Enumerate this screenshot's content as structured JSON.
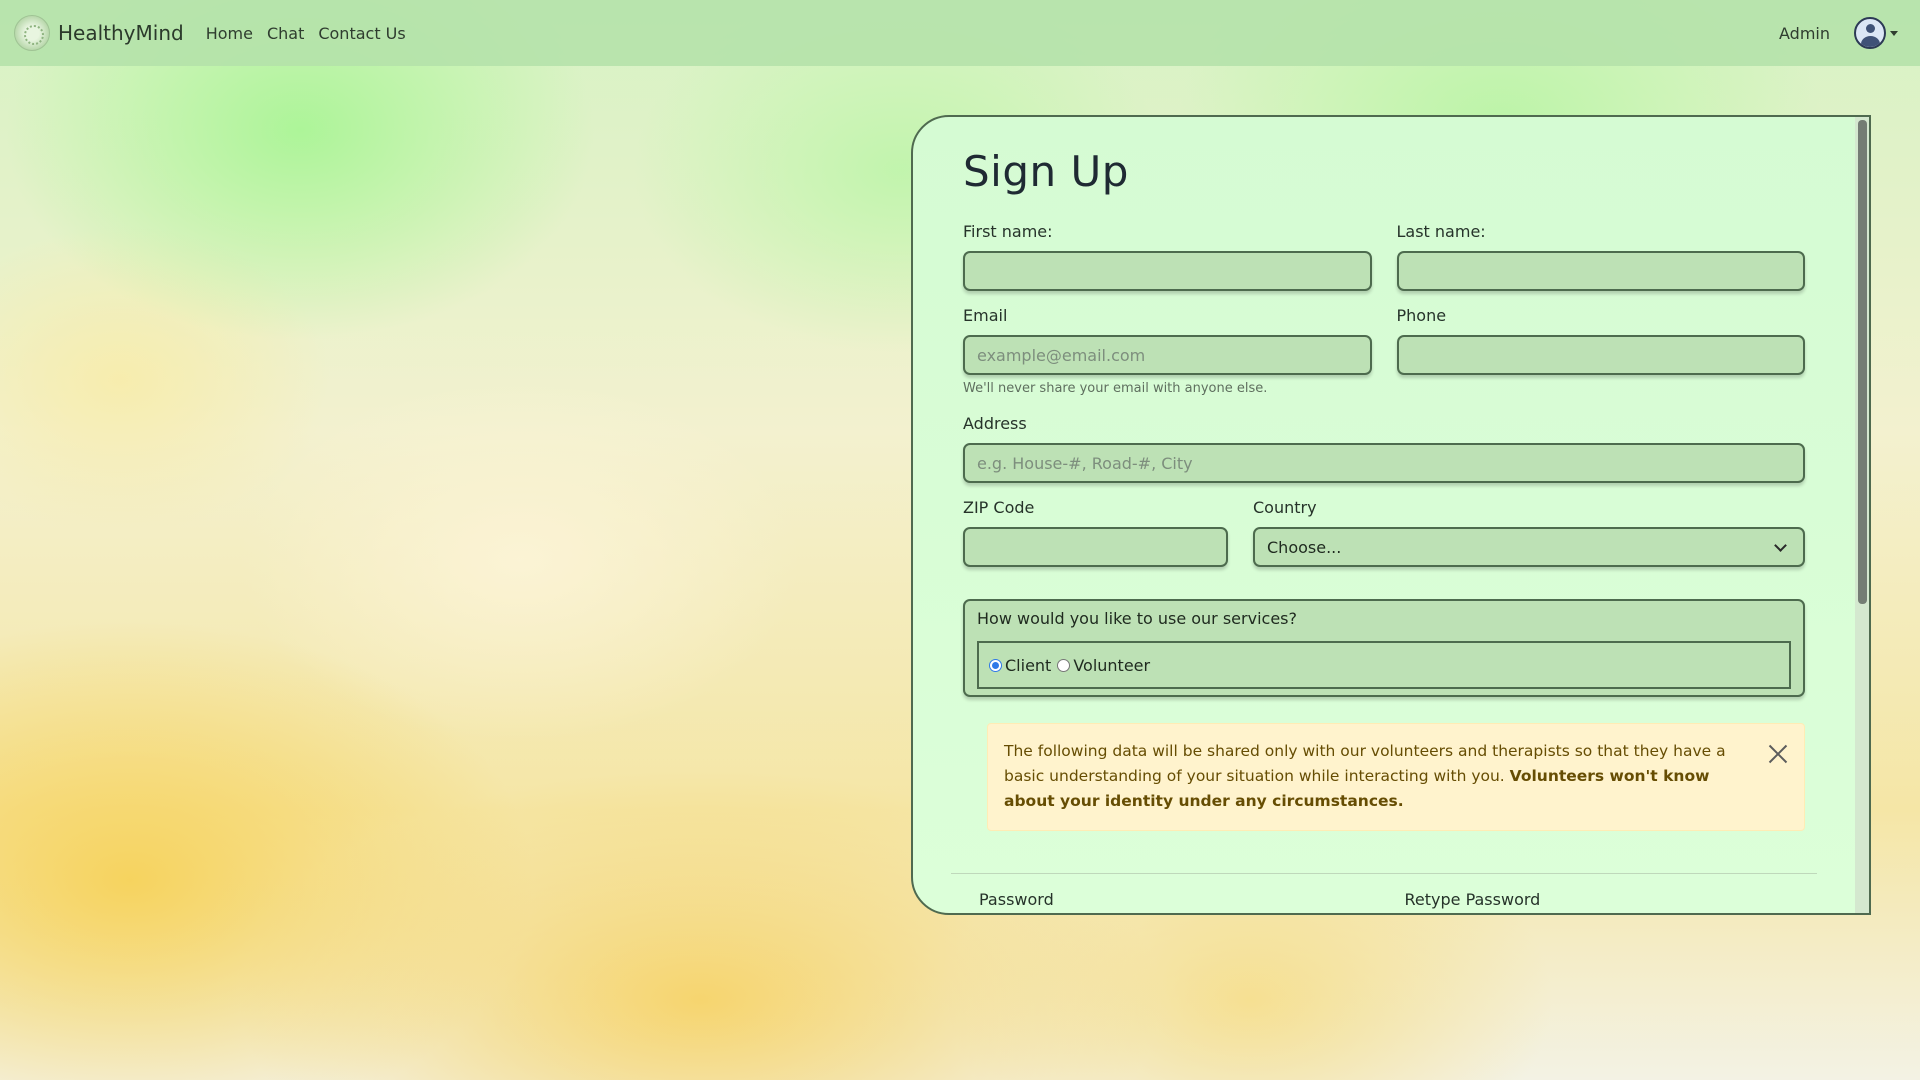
{
  "navbar": {
    "brand": "HealthyMind",
    "links": [
      "Home",
      "Chat",
      "Contact Us"
    ],
    "admin_label": "Admin"
  },
  "form": {
    "title": "Sign Up",
    "first_name_label": "First name:",
    "last_name_label": "Last name:",
    "email_label": "Email",
    "email_placeholder": "example@email.com",
    "email_help": "We'll never share your email with anyone else.",
    "phone_label": "Phone",
    "address_label": "Address",
    "address_placeholder": "e.g. House-#, Road-#, City",
    "zip_label": "ZIP Code",
    "country_label": "Country",
    "country_selected": "Choose...",
    "services_question": "How would you like to use our services?",
    "service_options": [
      {
        "label": "Client",
        "checked": true
      },
      {
        "label": "Volunteer",
        "checked": false
      }
    ],
    "alert_text": "The following data will be shared only with our volunteers and therapists so that they have a basic understanding of your situation while interacting with you.",
    "alert_bold": "Volunteers won't know about your identity under any circumstances.",
    "next_labels": [
      "Password",
      "Retype Password"
    ]
  },
  "colors": {
    "navbar_bg": "#b4e1aa",
    "card_bg": "#dcffd9",
    "input_bg": "#bde1b5",
    "alert_bg": "#fff3cd",
    "radio_accent": "#2f79e8"
  }
}
